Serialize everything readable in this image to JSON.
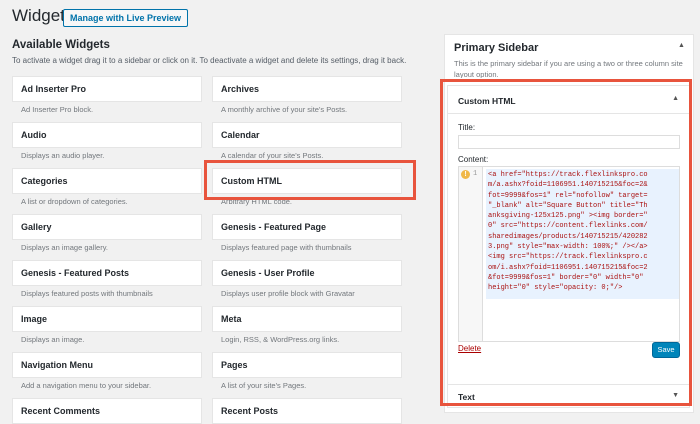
{
  "header": {
    "title": "Widgets",
    "preview_button": "Manage with Live Preview"
  },
  "available": {
    "title": "Available Widgets",
    "description": "To activate a widget drag it to a sidebar or click on it. To deactivate a widget and delete its settings, drag it back."
  },
  "widgets": [
    {
      "name": "Ad Inserter Pro",
      "desc": "Ad Inserter Pro block."
    },
    {
      "name": "Archives",
      "desc": "A monthly archive of your site's Posts."
    },
    {
      "name": "Audio",
      "desc": "Displays an audio player."
    },
    {
      "name": "Calendar",
      "desc": "A calendar of your site's Posts."
    },
    {
      "name": "Categories",
      "desc": "A list or dropdown of categories."
    },
    {
      "name": "Custom HTML",
      "desc": "Arbitrary HTML code."
    },
    {
      "name": "Gallery",
      "desc": "Displays an image gallery."
    },
    {
      "name": "Genesis - Featured Page",
      "desc": "Displays featured page with thumbnails"
    },
    {
      "name": "Genesis - Featured Posts",
      "desc": "Displays featured posts with thumbnails"
    },
    {
      "name": "Genesis - User Profile",
      "desc": "Displays user profile block with Gravatar"
    },
    {
      "name": "Image",
      "desc": "Displays an image."
    },
    {
      "name": "Meta",
      "desc": "Login, RSS, & WordPress.org links."
    },
    {
      "name": "Navigation Menu",
      "desc": "Add a navigation menu to your sidebar."
    },
    {
      "name": "Pages",
      "desc": "A list of your site's Pages."
    },
    {
      "name": "Recent Comments",
      "desc": ""
    },
    {
      "name": "Recent Posts",
      "desc": ""
    }
  ],
  "sidebar": {
    "title": "Primary Sidebar",
    "description": "This is the primary sidebar if you are using a two or three column site layout option.",
    "collapse_icon": "triangle-up-icon"
  },
  "custom_html_widget": {
    "title": "Custom HTML",
    "title_label": "Title:",
    "title_value": "",
    "content_label": "Content:",
    "line_number": "1",
    "warning_icon": "!",
    "code": "<a href=\"https://track.flexlinkspro.com/a.ashx?foid=1106951.140715215&foc=2&fot=9999&fos=1\" rel=\"nofollow\" target=\"_blank\" alt=\"Square Button\" title=\"Thanksgiving-125x125.png\" ><img border=\"0\" src=\"https://content.flexlinks.com/sharedimages/products/140715215/4202823.png\" style=\"max-width: 100%;\" /></a><img src=\"https://track.flexlinkspro.com/i.ashx?foid=1106951.140715215&foc=2&fot=9999&fos=1\" border=\"0\" width=\"0\" height=\"0\" style=\"opacity: 0;\"/>",
    "delete_label": "Delete",
    "save_label": "Save"
  },
  "next_widget": {
    "title": "Text"
  },
  "colors": {
    "highlight": "#e8543d",
    "primary_button": "#0085ba",
    "delete": "#a00"
  }
}
